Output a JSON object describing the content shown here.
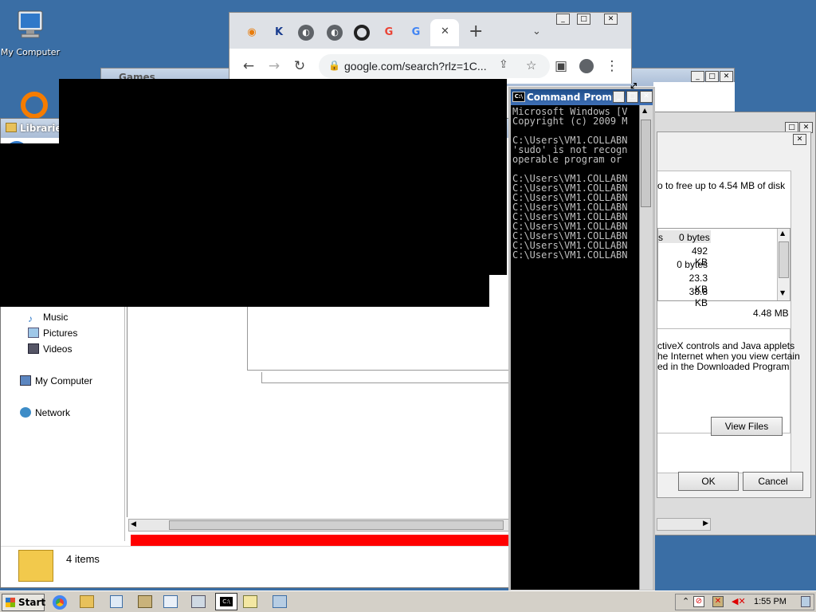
{
  "desktop": {
    "icons": [
      {
        "label": "My Computer"
      }
    ]
  },
  "browser": {
    "url": "google.com/search?rlz=1C...",
    "tabs": [
      {
        "icon": "blender-icon"
      },
      {
        "icon": "k-icon",
        "glyph": "K"
      },
      {
        "icon": "globe-icon"
      },
      {
        "icon": "globe-icon"
      },
      {
        "icon": "q-icon"
      },
      {
        "icon": "google-icon",
        "glyph": "G"
      },
      {
        "icon": "google-icon",
        "glyph": "G"
      }
    ],
    "new_tab": "+",
    "close_tab": "✕"
  },
  "games_window": {
    "title": "Games"
  },
  "explorer": {
    "title": "Libraries",
    "nav": {
      "music": "Music",
      "pictures": "Pictures",
      "videos": "Videos",
      "my_computer": "My Computer",
      "network": "Network"
    },
    "status": "4 items"
  },
  "cmd": {
    "title": "Command Prompt",
    "lines": "Microsoft Windows [V\nCopyright (c) 2009 M\n\nC:\\Users\\VM1.COLLABN\n'sudo' is not recogn\noperable program or \n\nC:\\Users\\VM1.COLLABN\nC:\\Users\\VM1.COLLABN\nC:\\Users\\VM1.COLLABN\nC:\\Users\\VM1.COLLABN\nC:\\Users\\VM1.COLLABN\nC:\\Users\\VM1.COLLABN\nC:\\Users\\VM1.COLLABN\nC:\\Users\\VM1.COLLABN\nC:\\Users\\VM1.COLLABN"
  },
  "disk_cleanup": {
    "intro": "o to free up to 4.54 MB of disk",
    "files": [
      {
        "name": "s",
        "size": "0 bytes"
      },
      {
        "size": "492 KB"
      },
      {
        "size": "0 bytes"
      },
      {
        "size": "23.3 KB"
      },
      {
        "size": "38.8 KB"
      }
    ],
    "total": "4.48 MB",
    "desc_line1": "ctiveX controls and Java applets",
    "desc_line2": "he Internet when you view certain",
    "desc_line3": "ed in the Downloaded Program",
    "view_files": "View Files",
    "ok": "OK",
    "cancel": "Cancel"
  },
  "taskbar": {
    "start": "Start",
    "clock": "1:55 PM"
  },
  "colors": {
    "desktop": "#3a6ea5",
    "cmd_title": "#2a5a9a",
    "redaction": "#000000",
    "red_bar": "#ff0000"
  }
}
